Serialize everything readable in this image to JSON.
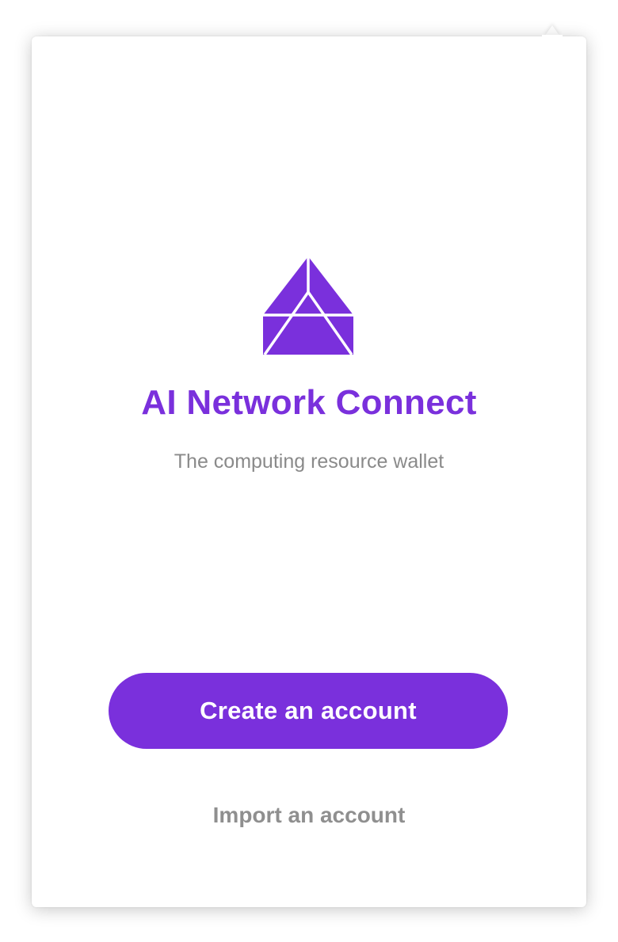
{
  "app": {
    "title": "AI Network Connect",
    "subtitle": "The computing resource wallet",
    "logo_icon": "ai-network-logo-icon"
  },
  "actions": {
    "create_label": "Create an account",
    "import_label": "Import an account"
  },
  "colors": {
    "brand": "#7a30dc",
    "subtitle": "#8a8a8a",
    "secondary_link": "#8f8f8f",
    "background": "#ffffff"
  }
}
